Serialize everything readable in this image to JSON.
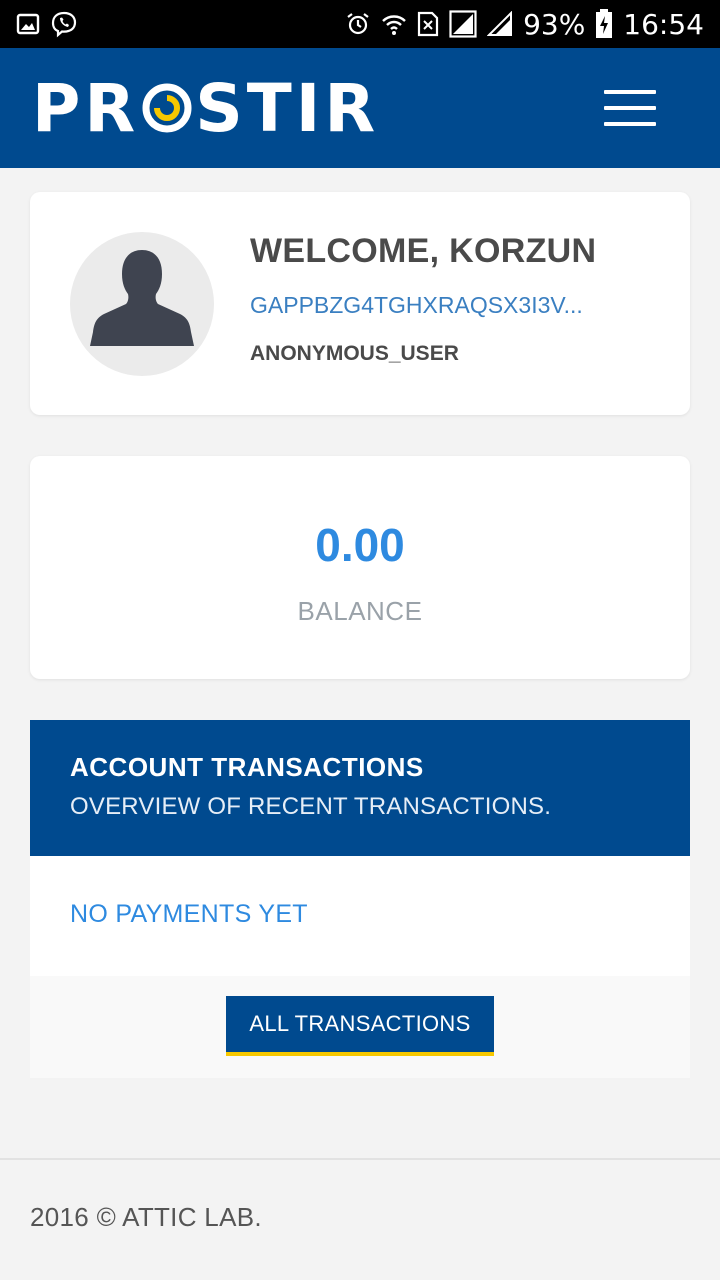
{
  "status_bar": {
    "battery": "93%",
    "time": "16:54"
  },
  "header": {
    "logo_text_left": "PR",
    "logo_text_right": "STIR",
    "colors": {
      "primary": "#004a8f",
      "accent": "#f7c800"
    }
  },
  "profile": {
    "welcome": "WELCOME, KORZUN",
    "account_id": "GAPPBZG4TGHXRAQSX3I3V...",
    "user_type": "ANONYMOUS_USER"
  },
  "balance": {
    "value": "0.00",
    "label": "BALANCE"
  },
  "transactions": {
    "title": "ACCOUNT TRANSACTIONS",
    "subtitle": "OVERVIEW OF RECENT TRANSACTIONS.",
    "empty_text": "NO PAYMENTS YET",
    "button_label": "ALL TRANSACTIONS"
  },
  "footer": {
    "text": "2016 © ATTIC LAB."
  }
}
